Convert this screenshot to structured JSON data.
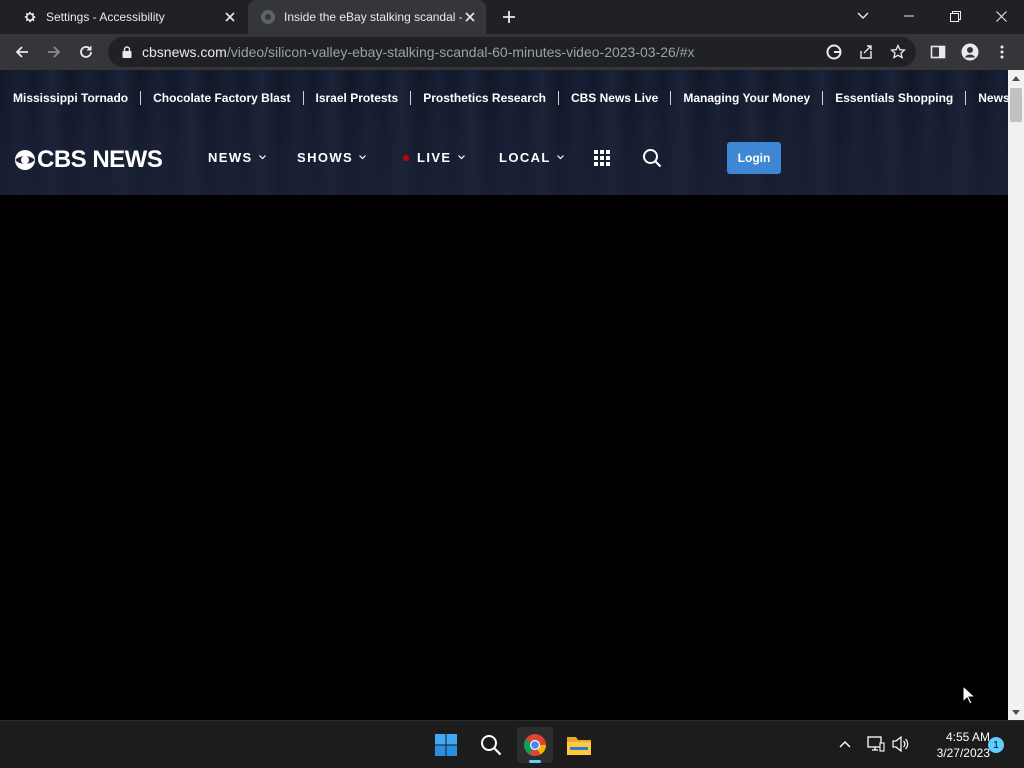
{
  "browser": {
    "tabs": [
      {
        "title": "Settings - Accessibility",
        "icon": "gear-icon",
        "active": false
      },
      {
        "title": "Inside the eBay stalking scandal -",
        "icon": "cbs-favicon-icon",
        "active": true
      }
    ],
    "address": {
      "host": "cbsnews.com",
      "path": "/video/silicon-valley-ebay-stalking-scandal-60-minutes-video-2023-03-26/#x"
    }
  },
  "site": {
    "trending": [
      "Mississippi Tornado",
      "Chocolate Factory Blast",
      "Israel Protests",
      "Prosthetics Research",
      "CBS News Live",
      "Managing Your Money",
      "Essentials Shopping",
      "Newsle"
    ],
    "logo_text": "CBS NEWS",
    "nav": {
      "news": "NEWS",
      "shows": "SHOWS",
      "live": "LIVE",
      "local": "LOCAL"
    },
    "login_label": "Login",
    "live_color": "#cc0000",
    "login_color": "#3d87d4"
  },
  "taskbar": {
    "apps": [
      "start-icon",
      "search-icon",
      "chrome-icon",
      "file-explorer-icon"
    ],
    "clock_time": "4:55 AM",
    "clock_date": "3/27/2023",
    "notification_count": "1"
  }
}
